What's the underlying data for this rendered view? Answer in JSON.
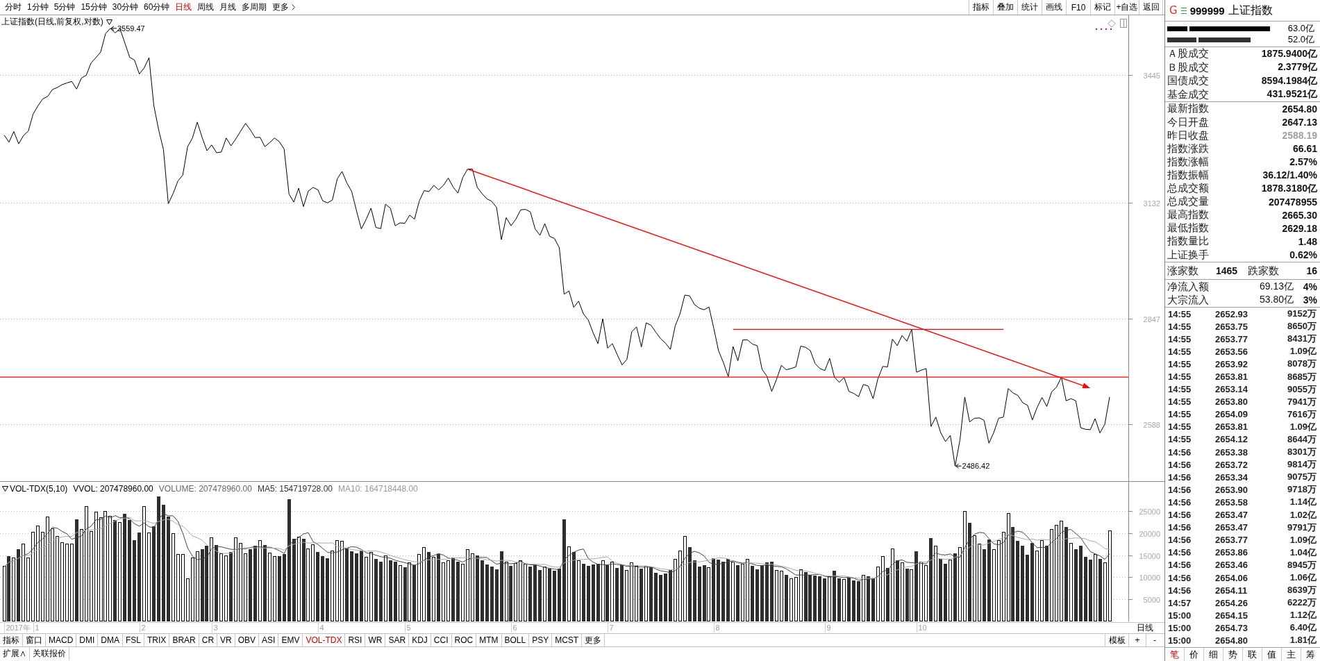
{
  "toolbar": {
    "periods": [
      {
        "label": "分时",
        "selected": false,
        "kind": "tab"
      },
      {
        "label": "1分钟",
        "selected": false,
        "kind": "tab"
      },
      {
        "label": "5分钟",
        "selected": false,
        "kind": "tab"
      },
      {
        "label": "15分钟",
        "selected": false,
        "kind": "tab"
      },
      {
        "label": "30分钟",
        "selected": false,
        "kind": "tab"
      },
      {
        "label": "60分钟",
        "selected": false,
        "kind": "tab"
      },
      {
        "label": "日线",
        "selected": true,
        "kind": "tab"
      },
      {
        "label": "周线",
        "selected": false,
        "kind": "tab"
      },
      {
        "label": "月线",
        "selected": false,
        "kind": "tab"
      },
      {
        "label": "多周期",
        "selected": false,
        "kind": "tab"
      },
      {
        "label": "更多",
        "selected": false,
        "kind": "more"
      }
    ],
    "actions": [
      "指标",
      "叠加",
      "统计",
      "画线",
      "F10",
      "标记",
      "+自选",
      "返回"
    ]
  },
  "price_pane": {
    "chart_data": {
      "type": "line",
      "title": "上证指数(日线,前复权,对数)",
      "ylim": [
        2448,
        3591
      ],
      "yticks": [
        3445,
        3132,
        2847,
        2588
      ],
      "grid": true,
      "series": [
        {
          "values": [
            3297,
            3280,
            3306,
            3276,
            3296,
            3307,
            3349,
            3369,
            3386,
            3392,
            3409,
            3414,
            3421,
            3425,
            3429,
            3410,
            3437,
            3444,
            3474,
            3487,
            3501,
            3546,
            3559,
            3548,
            3558,
            3523,
            3488,
            3481,
            3447,
            3462,
            3487,
            3370,
            3310,
            3262,
            3129,
            3154,
            3185,
            3199,
            3269,
            3290,
            3329,
            3292,
            3259,
            3273,
            3254,
            3256,
            3290,
            3271,
            3288,
            3307,
            3326,
            3310,
            3291,
            3292,
            3269,
            3279,
            3290,
            3281,
            3263,
            3153,
            3133,
            3167,
            3122,
            3160,
            3169,
            3163,
            3136,
            3131,
            3138,
            3190,
            3208,
            3180,
            3159,
            3111,
            3067,
            3091,
            3118,
            3071,
            3068,
            3128,
            3118,
            3075,
            3082,
            3081,
            3101,
            3091,
            3136,
            3161,
            3159,
            3174,
            3163,
            3174,
            3192,
            3170,
            3155,
            3193,
            3214,
            3214,
            3169,
            3154,
            3141,
            3135,
            3120,
            3041,
            3095,
            3075,
            3091,
            3114,
            3115,
            3109,
            3067,
            3052,
            3080,
            3049,
            3044,
            3021,
            2907,
            2915,
            2875,
            2890,
            2859,
            2844,
            2813,
            2786,
            2847,
            2775,
            2786,
            2759,
            2734,
            2747,
            2815,
            2827,
            2778,
            2837,
            2831,
            2814,
            2798,
            2787,
            2772,
            2829,
            2859,
            2905,
            2903,
            2882,
            2873,
            2869,
            2876,
            2824,
            2768,
            2740,
            2705,
            2779,
            2744,
            2795,
            2795,
            2785,
            2781,
            2723,
            2706,
            2669,
            2698,
            2733,
            2722,
            2725,
            2729,
            2780,
            2777,
            2769,
            2737,
            2725,
            2720,
            2750,
            2704,
            2691,
            2703,
            2669,
            2664,
            2656,
            2686,
            2682,
            2651,
            2700,
            2730,
            2729,
            2797,
            2781,
            2806,
            2792,
            2821,
            2716,
            2721,
            2725,
            2583,
            2606,
            2568,
            2546,
            2561,
            2486,
            2550,
            2655,
            2594,
            2603,
            2604,
            2598,
            2542,
            2568,
            2603,
            2606,
            2676,
            2665,
            2659,
            2641,
            2635,
            2599,
            2630,
            2654,
            2632,
            2668,
            2679,
            2704,
            2646,
            2651,
            2646,
            2580,
            2576,
            2575,
            2602,
            2567,
            2588,
            2655
          ]
        },
        {
          "color": "#ff0000",
          "values": [
            null,
            null,
            null,
            null,
            null,
            null,
            null,
            null,
            null,
            null,
            null,
            null,
            null,
            null,
            null,
            null,
            null,
            null,
            null,
            null,
            null,
            null,
            null,
            null,
            null,
            null,
            null,
            null,
            null,
            null,
            null,
            null,
            null,
            null,
            null,
            null,
            null,
            null,
            null,
            null,
            null,
            null,
            null,
            null,
            null,
            null,
            null,
            null,
            null,
            null,
            null,
            null,
            null,
            null,
            null,
            null,
            null,
            null,
            null,
            null,
            null,
            null,
            null,
            null,
            null,
            null,
            null,
            null,
            null,
            null,
            null,
            null,
            null,
            null,
            null,
            null,
            null,
            null,
            null,
            null,
            null,
            null,
            null,
            null,
            null,
            null,
            null,
            null,
            null,
            null,
            null,
            null,
            null,
            null,
            null,
            null,
            null,
            null,
            null,
            null,
            null,
            null,
            null,
            null,
            null,
            null,
            null,
            null,
            null,
            null,
            null,
            null,
            null,
            null,
            null,
            null,
            null,
            null,
            null,
            null,
            null,
            null,
            null,
            null,
            null,
            null,
            null,
            null,
            null,
            null,
            null,
            null,
            null,
            null,
            null,
            null,
            null,
            null,
            null,
            null,
            null,
            null,
            null,
            null,
            null,
            null,
            null,
            null,
            null,
            null,
            null,
            2821,
            2821,
            2821,
            2821,
            2821,
            2821,
            2821,
            2821,
            2821,
            2821,
            2821,
            2821,
            2821,
            2821,
            2821,
            2821,
            2821,
            2821,
            2821,
            2821,
            2821,
            2821,
            2821,
            2821,
            2821,
            2821,
            2821,
            2821,
            2821,
            2821,
            2821,
            2821,
            2821,
            2821,
            2821,
            2821,
            2821,
            2821,
            2821,
            2821,
            2821,
            2821,
            2821,
            2821,
            2821,
            2821,
            2821,
            2821,
            2821,
            2821,
            2821,
            2821,
            2821,
            2821,
            2821,
            2821,
            2821,
            null,
            null,
            null,
            null,
            null,
            null,
            null,
            null,
            null,
            null,
            null,
            null,
            null,
            null,
            null,
            null,
            null,
            null,
            null,
            null,
            null,
            null
          ]
        }
      ],
      "annotations": [
        "3559.47",
        "2486.42"
      ],
      "ref_lines": [
        {
          "axis": "y",
          "value": 2704
        }
      ]
    }
  },
  "volume_pane": {
    "indicator": "VOL-TDX(5,10)",
    "readouts": [
      {
        "text": "VVOL: 207478960.00",
        "color": "#000000"
      },
      {
        "text": "VOLUME: 207478960.00",
        "color": "#666666"
      },
      {
        "text": "MA5: 154719728.00",
        "color": "#333333"
      },
      {
        "text": "MA10: 164718448.00",
        "color": "#999999"
      }
    ],
    "volume_chart": {
      "chart_data": {
        "type": "bar",
        "ylim": [
          0,
          31800
        ],
        "yticks": [
          5000,
          10000,
          15000,
          20000,
          25000
        ],
        "grid": true,
        "values": [
          12500,
          14800,
          14400,
          16400,
          17600,
          14400,
          20300,
          21700,
          20300,
          23800,
          21200,
          19400,
          18000,
          17600,
          17600,
          23200,
          21000,
          26200,
          20500,
          24900,
          23600,
          25000,
          24000,
          23000,
          22500,
          24400,
          23000,
          18500,
          20200,
          26200,
          20100,
          21600,
          28400,
          26500,
          23800,
          20000,
          15300,
          15300,
          9800,
          14500,
          15900,
          16400,
          17200,
          19000,
          17300,
          15400,
          15000,
          15800,
          19000,
          17800,
          15500,
          16300,
          17200,
          18400,
          17400,
          15600,
          14800,
          14800,
          15200,
          27800,
          18800,
          19300,
          18800,
          16600,
          17500,
          15800,
          14800,
          14300,
          16100,
          18500,
          18300,
          16700,
          15900,
          15400,
          16000,
          14600,
          15800,
          14200,
          13600,
          15000,
          13900,
          13500,
          12800,
          12300,
          13300,
          12800,
          15200,
          16900,
          15800,
          14700,
          15200,
          13300,
          13800,
          14400,
          13500,
          13100,
          16300,
          15400,
          14900,
          13800,
          12900,
          12400,
          11800,
          15900,
          13600,
          12500,
          13200,
          13800,
          13000,
          12400,
          12800,
          11600,
          12400,
          11900,
          11500,
          11900,
          23200,
          17000,
          15700,
          13900,
          13100,
          12500,
          12900,
          13000,
          13800,
          12800,
          13600,
          12100,
          12900,
          11700,
          13400,
          12600,
          11900,
          12600,
          12200,
          11000,
          10600,
          10900,
          11600,
          14200,
          16100,
          19400,
          16800,
          13800,
          12400,
          12700,
          12300,
          14300,
          14000,
          13600,
          14100,
          13600,
          12700,
          13000,
          14200,
          12500,
          11800,
          12700,
          13400,
          13600,
          11700,
          11400,
          10500,
          9800,
          10100,
          11800,
          11200,
          10600,
          10400,
          10200,
          9700,
          10200,
          11400,
          9800,
          9500,
          9900,
          9300,
          9100,
          10500,
          10200,
          9700,
          12400,
          14800,
          12100,
          16500,
          13800,
          13400,
          12000,
          11800,
          15900,
          13500,
          12800,
          18900,
          17200,
          14200,
          13000,
          14000,
          15500,
          16900,
          25000,
          22400,
          19600,
          17700,
          16400,
          18600,
          16400,
          18500,
          20300,
          24600,
          21400,
          18200,
          17200,
          15100,
          17800,
          16100,
          18500,
          17100,
          21000,
          21900,
          22800,
          21400,
          17800,
          16400,
          17200,
          14600,
          14000,
          15200,
          14100,
          13300,
          20700
        ]
      }
    },
    "average_chart": {
      "chart_data": {
        "type": "line",
        "ylim": [
          0,
          31800
        ],
        "series": [
          {
            "color": "#444444",
            "values": [
              12500,
              13650,
              13900,
              14530,
              15140,
              15520,
              16620,
              18080,
              18860,
              20100,
              21460,
              21280,
              20540,
              20000,
              18760,
              19160,
              19480,
              21120,
              21700,
              23160,
              23240,
              24040,
              23600,
              24100,
              23620,
              23780,
              23380,
              22280,
              21720,
              22460,
              21600,
              21320,
              23300,
              24560,
              24080,
              24060,
              22800,
              20180,
              16840,
              14980,
              14160,
              14380,
              14760,
              16600,
              17160,
              17060,
              16780,
              16500,
              16500,
              16600,
              16620,
              16880,
              17160,
              17040,
              16960,
              16980,
              16680,
              16200,
              15560,
              17640,
              18280,
              19180,
              19980,
              20260,
              18200,
              17600,
              16700,
              15800,
              15700,
              15900,
              16400,
              16780,
              17100,
              16960,
              16460,
              15720,
              15540,
              15200,
              14840,
              14640,
              14500,
              14040,
              13760,
              13500,
              13160,
              12940,
              13280,
              14100,
              14800,
              15080,
              15560,
              15180,
              14560,
              14280,
              14040,
              13620,
              14220,
              14540,
              14640,
              14700,
              14660,
              13880,
              13160,
              13360,
              13320,
              13240,
              13400,
              13800,
              13220,
              12980,
              13040,
              12720,
              12440,
              12220,
              12040,
              11860,
              14180,
              15100,
              15860,
              16340,
              16580,
              14440,
              13620,
              13080,
              13060,
              13000,
              13220,
              13060,
              13040,
              12620,
              12740,
              12540,
              12500,
              12440,
              12540,
              12060,
              11660,
              11460,
              11260,
              11660,
              12680,
              14440,
              15620,
              16060,
              15700,
              15020,
              13600,
              13100,
              13140,
              13380,
              13660,
              13920,
              13600,
              13400,
              13520,
              13200,
              12840,
              12840,
              12920,
              12800,
              12640,
              12560,
              12120,
              11400,
              10700,
              10720,
              10680,
              10700,
              10820,
              10840,
              10420,
              10220,
              10380,
              10260,
              10120,
              10160,
              9980,
              9520,
              9660,
              9800,
              9760,
              10380,
              11520,
              11840,
              13100,
              13920,
              14120,
              13560,
              13500,
              13380,
              13320,
              13200,
              14580,
              15660,
              15320,
              15220,
              15460,
              14780,
              14720,
              16880,
              18760,
              19880,
              20320,
              20220,
              18940,
              17740,
              17520,
              18040,
              19680,
              20240,
              20600,
              20340,
              19300,
              17940,
              16880,
              16940,
              16920,
              18100,
              18920,
              20260,
              20840,
              20980,
              20060,
              19120,
              17480,
              16000,
              15480,
              15020,
              14240,
              15460
            ]
          },
          {
            "color": "#aaaaaa",
            "values": [
              12500,
              13650,
              13900,
              14530,
              15140,
              15020,
              15770,
              16510,
              16930,
              17620,
              18490,
              18950,
              19310,
              19430,
              19430,
              20310,
              20380,
              20830,
              20850,
              20960,
              21200,
              21760,
              22360,
              22900,
              23390,
              23510,
              23710,
              22940,
              22910,
              23040,
              22690,
              22350,
              22790,
              23140,
              23270,
              22830,
              22060,
              21740,
              20700,
              19530,
              19110,
              18590,
              17470,
              16720,
              16070,
              15610,
              15580,
              15630,
              16550,
              16880,
              16840,
              16830,
              16830,
              16770,
              16780,
              16800,
              16780,
              16680,
              16300,
              17300,
              17630,
              17930,
              18090,
              17910,
              17920,
              17940,
              17940,
              17890,
              17980,
              17050,
              17000,
              16740,
              16450,
              16330,
              16180,
              16060,
              16160,
              16150,
              15900,
              15550,
              15110,
              14790,
              14480,
              14170,
              13900,
              13720,
              13660,
              13930,
              14150,
              14120,
              14250,
              14230,
              14330,
              14540,
              14560,
              14590,
              14700,
              14550,
              14460,
              14370,
              14140,
              14050,
              13850,
              14000,
              14010,
              13950,
              13640,
              13480,
              13290,
              13150,
              13140,
              13060,
              13120,
              12720,
              12510,
              12450,
              13450,
              13770,
              14040,
              14190,
              14220,
              14310,
              14360,
              14470,
              14700,
              14790,
              13830,
              13340,
              13060,
              12840,
              12870,
              12880,
              12780,
              12740,
              12580,
              12400,
              12100,
              11980,
              11850,
              12100,
              12370,
              13050,
              13540,
              13660,
              13680,
              13850,
              14020,
              14360,
              14600,
              14540,
              14340,
              13760,
              13350,
              13270,
              13450,
              13430,
              13380,
              13220,
              13160,
              13160,
              12920,
              12700,
              12480,
              12160,
              11750,
              11680,
              11620,
              11410,
              11110,
              10770,
              10570,
              10450,
              10540,
              10540,
              10480,
              10290,
              10100,
              9950,
              9960,
              9960,
              9960,
              10180,
              10520,
              10750,
              11450,
              11840,
              12250,
              12540,
              12670,
              13240,
              13620,
              13660,
              14070,
              14580,
              14350,
              14270,
              14330,
              14680,
              15190,
              16100,
              16990,
              17670,
              17550,
              17470,
              17910,
              18250,
              18700,
              19180,
              19950,
              19590,
              19170,
              18930,
              18670,
              18810,
              18560,
              18770,
              18630,
              18700,
              18430,
              18570,
              18890,
              18950,
              19080,
              19020,
              18870,
              18420,
              18230,
              17540,
              16680,
              16470
            ]
          }
        ]
      }
    },
    "date_axis": [
      "2017年",
      "1",
      "2",
      "3",
      "4",
      "5",
      "6",
      "7",
      "8",
      "9",
      "10"
    ],
    "period_label": "日线"
  },
  "indicator_bar": {
    "buttons": [
      "指标",
      "窗口"
    ],
    "tabs": [
      {
        "label": "MACD",
        "selected": false
      },
      {
        "label": "DMI",
        "selected": false
      },
      {
        "label": "DMA",
        "selected": false
      },
      {
        "label": "FSL",
        "selected": false
      },
      {
        "label": "TRIX",
        "selected": false
      },
      {
        "label": "BRAR",
        "selected": false
      },
      {
        "label": "CR",
        "selected": false
      },
      {
        "label": "VR",
        "selected": false
      },
      {
        "label": "OBV",
        "selected": false
      },
      {
        "label": "ASI",
        "selected": false
      },
      {
        "label": "EMV",
        "selected": false
      },
      {
        "label": "VOL-TDX",
        "selected": true
      },
      {
        "label": "RSI",
        "selected": false
      },
      {
        "label": "WR",
        "selected": false
      },
      {
        "label": "SAR",
        "selected": false
      },
      {
        "label": "KDJ",
        "selected": false
      },
      {
        "label": "CCI",
        "selected": false
      },
      {
        "label": "ROC",
        "selected": false
      },
      {
        "label": "MTM",
        "selected": false
      },
      {
        "label": "BOLL",
        "selected": false
      },
      {
        "label": "PSY",
        "selected": false
      },
      {
        "label": "MCST",
        "selected": false
      }
    ],
    "more": "更多",
    "template_buttons": [
      "模板",
      "+",
      "-"
    ]
  },
  "extra_bar": [
    "扩展∧",
    "关联报价"
  ],
  "quote_panel": {
    "badge": "G",
    "code": "999999",
    "name": "上证指数",
    "flow_bars": [
      {
        "color": "#000000",
        "value": "63.0亿",
        "segments": [
          {
            "level": 0.19
          },
          {
            "level": 0.98
          }
        ]
      },
      {
        "color": "#333333",
        "value": "52.0亿",
        "segments": [
          {
            "level": 0.28
          },
          {
            "level": 0.71
          }
        ]
      }
    ],
    "turnover": [
      {
        "label": "Ａ股成交",
        "value": "1875.9400亿"
      },
      {
        "label": "Ｂ股成交",
        "value": "2.3779亿"
      },
      {
        "label": "国债成交",
        "value": "8594.1984亿"
      },
      {
        "label": "基金成交",
        "value": "431.9521亿"
      }
    ],
    "stats": [
      {
        "label": "最新指数",
        "value": "2654.80",
        "muted": false
      },
      {
        "label": "今日开盘",
        "value": "2647.13",
        "muted": false
      },
      {
        "label": "昨日收盘",
        "value": "2588.19",
        "muted": true
      },
      {
        "label": "指数涨跌",
        "value": "66.61",
        "muted": false
      },
      {
        "label": "指数涨幅",
        "value": "2.57%",
        "muted": false
      },
      {
        "label": "指数振幅",
        "value": "36.12/1.40%",
        "muted": false
      },
      {
        "label": "总成交额",
        "value": "1878.3180亿",
        "muted": false
      },
      {
        "label": "总成交量",
        "value": "207478955",
        "muted": false
      },
      {
        "label": "最高指数",
        "value": "2665.30",
        "muted": false
      },
      {
        "label": "最低指数",
        "value": "2629.18",
        "muted": false
      },
      {
        "label": "指数量比",
        "value": "1.48",
        "muted": false
      },
      {
        "label": "上证换手",
        "value": "0.62%",
        "muted": false
      }
    ],
    "breadth": {
      "up_label": "涨家数",
      "up_count": "1465",
      "down_label": "跌家数",
      "down_count": "16"
    },
    "flows": [
      {
        "label": "净流入额",
        "amount": "69.13亿",
        "percent": "4%"
      },
      {
        "label": "大宗流入",
        "amount": "53.80亿",
        "percent": "3%"
      }
    ],
    "ticks": [
      {
        "time": "14:55",
        "price": "2652.93",
        "volume": "9152万"
      },
      {
        "time": "14:55",
        "price": "2653.75",
        "volume": "8650万"
      },
      {
        "time": "14:55",
        "price": "2653.77",
        "volume": "8431万"
      },
      {
        "time": "14:55",
        "price": "2653.56",
        "volume": "1.09亿"
      },
      {
        "time": "14:55",
        "price": "2653.92",
        "volume": "8078万"
      },
      {
        "time": "14:55",
        "price": "2653.81",
        "volume": "8685万"
      },
      {
        "time": "14:55",
        "price": "2653.14",
        "volume": "9055万"
      },
      {
        "time": "14:55",
        "price": "2653.80",
        "volume": "7941万"
      },
      {
        "time": "14:55",
        "price": "2654.09",
        "volume": "7616万"
      },
      {
        "time": "14:55",
        "price": "2653.81",
        "volume": "1.09亿"
      },
      {
        "time": "14:55",
        "price": "2654.12",
        "volume": "8644万"
      },
      {
        "time": "14:56",
        "price": "2653.38",
        "volume": "8301万"
      },
      {
        "time": "14:56",
        "price": "2653.72",
        "volume": "9814万"
      },
      {
        "time": "14:56",
        "price": "2653.34",
        "volume": "9075万"
      },
      {
        "time": "14:56",
        "price": "2653.90",
        "volume": "9718万"
      },
      {
        "time": "14:56",
        "price": "2653.58",
        "volume": "1.14亿"
      },
      {
        "time": "14:56",
        "price": "2653.47",
        "volume": "1.02亿"
      },
      {
        "time": "14:56",
        "price": "2653.47",
        "volume": "9791万"
      },
      {
        "time": "14:56",
        "price": "2653.77",
        "volume": "1.09亿"
      },
      {
        "time": "14:56",
        "price": "2653.86",
        "volume": "1.04亿"
      },
      {
        "time": "14:56",
        "price": "2653.46",
        "volume": "8945万"
      },
      {
        "time": "14:56",
        "price": "2654.06",
        "volume": "1.06亿"
      },
      {
        "time": "14:56",
        "price": "2654.11",
        "volume": "8639万"
      },
      {
        "time": "14:57",
        "price": "2654.26",
        "volume": "6222万"
      },
      {
        "time": "15:00",
        "price": "2654.15",
        "volume": "1.12亿"
      },
      {
        "time": "15:00",
        "price": "2654.73",
        "volume": "6.40亿"
      },
      {
        "time": "15:00",
        "price": "2654.80",
        "volume": "1.81亿"
      }
    ],
    "tabs": [
      {
        "label": "笔",
        "selected": true
      },
      {
        "label": "价",
        "selected": false
      },
      {
        "label": "细",
        "selected": false
      },
      {
        "label": "势",
        "selected": false
      },
      {
        "label": "联",
        "selected": false
      },
      {
        "label": "值",
        "selected": false
      },
      {
        "label": "主",
        "selected": false
      },
      {
        "label": "筹",
        "selected": false
      }
    ]
  }
}
